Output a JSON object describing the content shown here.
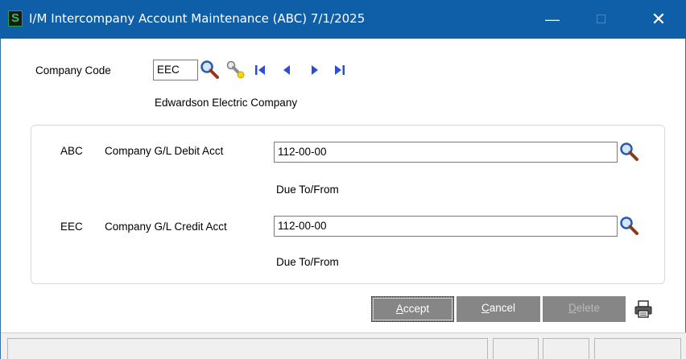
{
  "window": {
    "title": "I/M Intercompany Account Maintenance (ABC) 7/1/2025",
    "app_icon_glyph": "S",
    "minimize_glyph": "—",
    "close_glyph": "✕"
  },
  "company": {
    "label": "Company Code",
    "value": "EEC",
    "name": "Edwardson Electric Company"
  },
  "accounts": [
    {
      "company": "ABC",
      "label": "Company G/L Debit Acct",
      "value": "112-00-00",
      "description": "Due To/From"
    },
    {
      "company": "EEC",
      "label": "Company G/L Credit Acct",
      "value": "112-00-00",
      "description": "Due To/From"
    }
  ],
  "buttons": {
    "accept_key": "A",
    "accept_rest": "ccept",
    "cancel_key": "C",
    "cancel_rest": "ancel",
    "delete_key": "D",
    "delete_rest": "elete"
  },
  "icons": {
    "lookup": "magnifier-icon",
    "pointer": "flashlight-icon",
    "first": "first-record-icon",
    "prev": "previous-record-icon",
    "next": "next-record-icon",
    "last": "last-record-icon",
    "print": "printer-icon"
  },
  "colors": {
    "titlebar": "#0f5fa8",
    "nav_blue": "#2a4fd6",
    "button_gray": "#868686"
  }
}
